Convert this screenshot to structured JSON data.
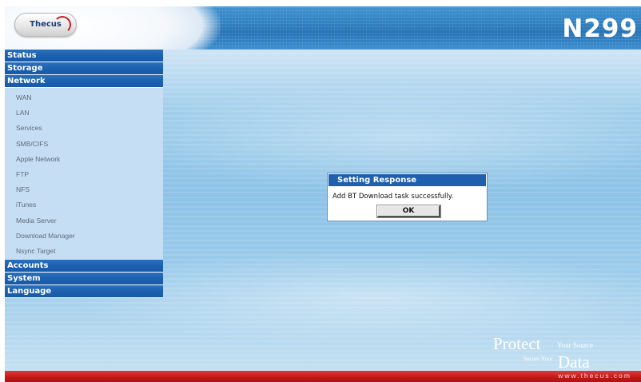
{
  "header": {
    "logo_text": "Thecus",
    "model": "N299"
  },
  "sidebar": {
    "categories_top": [
      {
        "label": "Status"
      },
      {
        "label": "Storage"
      },
      {
        "label": "Network"
      }
    ],
    "network_items": [
      {
        "label": "WAN"
      },
      {
        "label": "LAN"
      },
      {
        "label": "Services"
      },
      {
        "label": "SMB/CIFS"
      },
      {
        "label": "Apple Network"
      },
      {
        "label": "FTP"
      },
      {
        "label": "NFS"
      },
      {
        "label": "iTunes"
      },
      {
        "label": "Media Server"
      },
      {
        "label": "Download Manager"
      },
      {
        "label": "Nsync Target"
      }
    ],
    "categories_bottom": [
      {
        "label": "Accounts"
      },
      {
        "label": "System"
      },
      {
        "label": "Language"
      }
    ]
  },
  "dialog": {
    "title": "Setting Response",
    "message": "Add BT Download task successfully.",
    "ok_label": "OK"
  },
  "slogan": {
    "line1_big": "Protect",
    "line1_small": "Your Source",
    "line2_small": "Secure Your",
    "line2_big": "Data"
  },
  "footer": {
    "url": "www.thecus.com"
  }
}
